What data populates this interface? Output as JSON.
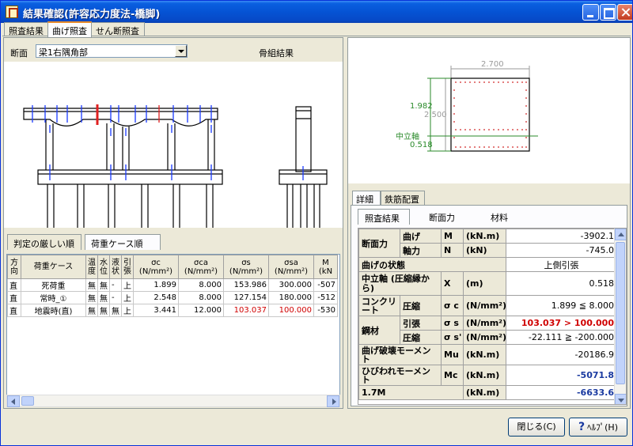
{
  "window": {
    "title": "結果確認(許容応力度法-橋脚)"
  },
  "main_tabs": [
    {
      "label": "照査結果"
    },
    {
      "label": "曲げ照査"
    },
    {
      "label": "せん断照査"
    }
  ],
  "left": {
    "section_label": "断面",
    "section_selected": "梁1右隅角部",
    "frame_title": "骨組結果",
    "sub_tabs": [
      {
        "label": "判定の厳しい順"
      },
      {
        "label": "荷重ケース順"
      }
    ],
    "grid": {
      "headers": [
        "方向",
        "荷重ケース",
        "温度",
        "水位",
        "液状",
        "引張",
        "σc (N/mm²)",
        "σca (N/mm²)",
        "σs (N/mm²)",
        "σsa (N/mm²)",
        "M (kN"
      ],
      "rows": [
        [
          "直",
          "死荷重",
          "無",
          "無",
          "-",
          "上",
          "1.899",
          "8.000",
          "153.986",
          "300.000",
          "-507"
        ],
        [
          "直",
          "常時_①",
          "無",
          "無",
          "-",
          "上",
          "2.548",
          "8.000",
          "127.154",
          "180.000",
          "-512"
        ],
        [
          "直",
          "地震時(直)",
          "無",
          "無",
          "無",
          "上",
          "3.441",
          "12.000",
          "103.037",
          "100.000",
          "-530"
        ]
      ]
    }
  },
  "right": {
    "section_view": {
      "width_label": "2.700",
      "height_label": "2.500",
      "upper_dim": "1.982",
      "neutral_axis_label": "中立軸",
      "neutral_dim": "0.518"
    },
    "detail_tabs": [
      {
        "label": "詳細"
      },
      {
        "label": "鉄筋配置"
      }
    ],
    "result_tabs": [
      {
        "label": "照査結果"
      },
      {
        "label": "断面力"
      },
      {
        "label": "材料"
      }
    ],
    "detail": {
      "sectional_force": "断面力",
      "bending": "曲げ",
      "sym_M": "M",
      "unit_kNm": "(kN.m)",
      "M_val": "-3902.1",
      "axial": "軸力",
      "sym_N": "N",
      "unit_kN": "(kN)",
      "N_val": "-745.0",
      "bend_state": "曲げの状態",
      "bend_state_val": "上側引張",
      "neutral_axis": "中立軸 (圧縮縁から)",
      "sym_x": "X",
      "unit_m": "(m)",
      "x_val": "0.518",
      "concrete": "コンクリート",
      "compression": "圧縮",
      "sym_sc": "σ c",
      "unit_nmm": "(N/mm²)",
      "sc_val": "1.899  ≦  8.000",
      "steel": "鋼材",
      "tension": "引張",
      "sym_ss": "σ s",
      "ss_val": "103.037  >  100.000",
      "compression2": "圧縮",
      "sym_ss2": "σ s'",
      "ss2_val": "-22.111  ≧  -200.000",
      "mu": "曲げ破壊モーメント",
      "sym_mu": "Mu",
      "mu_val": "-20186.9",
      "mc": "ひびわれモーメント",
      "sym_mc": "Mc",
      "mc_val": "-5071.8",
      "m17": "1.7M",
      "m17_val": "-6633.6"
    }
  },
  "buttons": {
    "close": "閉じる(C)",
    "help": "ﾍﾙﾌﾟ(H)"
  }
}
